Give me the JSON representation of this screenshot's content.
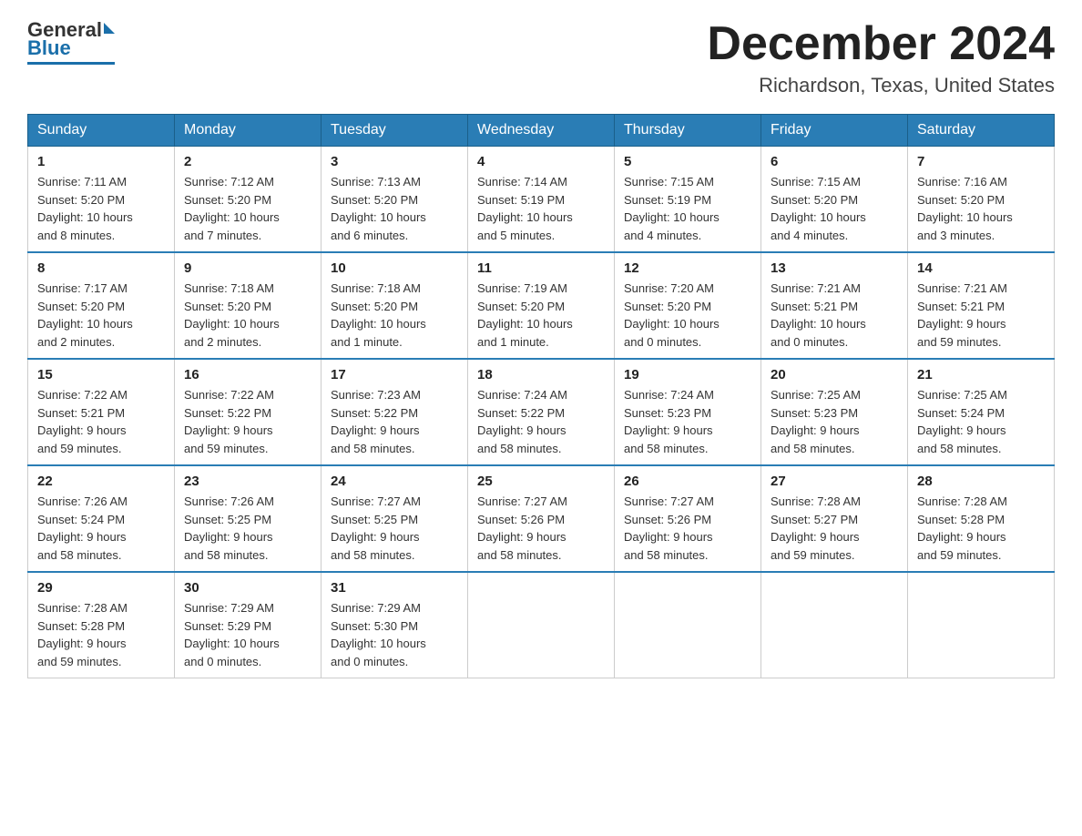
{
  "logo": {
    "general": "General",
    "blue": "Blue"
  },
  "title": "December 2024",
  "subtitle": "Richardson, Texas, United States",
  "days_of_week": [
    "Sunday",
    "Monday",
    "Tuesday",
    "Wednesday",
    "Thursday",
    "Friday",
    "Saturday"
  ],
  "weeks": [
    [
      {
        "day": "1",
        "sunrise": "7:11 AM",
        "sunset": "5:20 PM",
        "daylight": "10 hours and 8 minutes."
      },
      {
        "day": "2",
        "sunrise": "7:12 AM",
        "sunset": "5:20 PM",
        "daylight": "10 hours and 7 minutes."
      },
      {
        "day": "3",
        "sunrise": "7:13 AM",
        "sunset": "5:20 PM",
        "daylight": "10 hours and 6 minutes."
      },
      {
        "day": "4",
        "sunrise": "7:14 AM",
        "sunset": "5:19 PM",
        "daylight": "10 hours and 5 minutes."
      },
      {
        "day": "5",
        "sunrise": "7:15 AM",
        "sunset": "5:19 PM",
        "daylight": "10 hours and 4 minutes."
      },
      {
        "day": "6",
        "sunrise": "7:15 AM",
        "sunset": "5:20 PM",
        "daylight": "10 hours and 4 minutes."
      },
      {
        "day": "7",
        "sunrise": "7:16 AM",
        "sunset": "5:20 PM",
        "daylight": "10 hours and 3 minutes."
      }
    ],
    [
      {
        "day": "8",
        "sunrise": "7:17 AM",
        "sunset": "5:20 PM",
        "daylight": "10 hours and 2 minutes."
      },
      {
        "day": "9",
        "sunrise": "7:18 AM",
        "sunset": "5:20 PM",
        "daylight": "10 hours and 2 minutes."
      },
      {
        "day": "10",
        "sunrise": "7:18 AM",
        "sunset": "5:20 PM",
        "daylight": "10 hours and 1 minute."
      },
      {
        "day": "11",
        "sunrise": "7:19 AM",
        "sunset": "5:20 PM",
        "daylight": "10 hours and 1 minute."
      },
      {
        "day": "12",
        "sunrise": "7:20 AM",
        "sunset": "5:20 PM",
        "daylight": "10 hours and 0 minutes."
      },
      {
        "day": "13",
        "sunrise": "7:21 AM",
        "sunset": "5:21 PM",
        "daylight": "10 hours and 0 minutes."
      },
      {
        "day": "14",
        "sunrise": "7:21 AM",
        "sunset": "5:21 PM",
        "daylight": "9 hours and 59 minutes."
      }
    ],
    [
      {
        "day": "15",
        "sunrise": "7:22 AM",
        "sunset": "5:21 PM",
        "daylight": "9 hours and 59 minutes."
      },
      {
        "day": "16",
        "sunrise": "7:22 AM",
        "sunset": "5:22 PM",
        "daylight": "9 hours and 59 minutes."
      },
      {
        "day": "17",
        "sunrise": "7:23 AM",
        "sunset": "5:22 PM",
        "daylight": "9 hours and 58 minutes."
      },
      {
        "day": "18",
        "sunrise": "7:24 AM",
        "sunset": "5:22 PM",
        "daylight": "9 hours and 58 minutes."
      },
      {
        "day": "19",
        "sunrise": "7:24 AM",
        "sunset": "5:23 PM",
        "daylight": "9 hours and 58 minutes."
      },
      {
        "day": "20",
        "sunrise": "7:25 AM",
        "sunset": "5:23 PM",
        "daylight": "9 hours and 58 minutes."
      },
      {
        "day": "21",
        "sunrise": "7:25 AM",
        "sunset": "5:24 PM",
        "daylight": "9 hours and 58 minutes."
      }
    ],
    [
      {
        "day": "22",
        "sunrise": "7:26 AM",
        "sunset": "5:24 PM",
        "daylight": "9 hours and 58 minutes."
      },
      {
        "day": "23",
        "sunrise": "7:26 AM",
        "sunset": "5:25 PM",
        "daylight": "9 hours and 58 minutes."
      },
      {
        "day": "24",
        "sunrise": "7:27 AM",
        "sunset": "5:25 PM",
        "daylight": "9 hours and 58 minutes."
      },
      {
        "day": "25",
        "sunrise": "7:27 AM",
        "sunset": "5:26 PM",
        "daylight": "9 hours and 58 minutes."
      },
      {
        "day": "26",
        "sunrise": "7:27 AM",
        "sunset": "5:26 PM",
        "daylight": "9 hours and 58 minutes."
      },
      {
        "day": "27",
        "sunrise": "7:28 AM",
        "sunset": "5:27 PM",
        "daylight": "9 hours and 59 minutes."
      },
      {
        "day": "28",
        "sunrise": "7:28 AM",
        "sunset": "5:28 PM",
        "daylight": "9 hours and 59 minutes."
      }
    ],
    [
      {
        "day": "29",
        "sunrise": "7:28 AM",
        "sunset": "5:28 PM",
        "daylight": "9 hours and 59 minutes."
      },
      {
        "day": "30",
        "sunrise": "7:29 AM",
        "sunset": "5:29 PM",
        "daylight": "10 hours and 0 minutes."
      },
      {
        "day": "31",
        "sunrise": "7:29 AM",
        "sunset": "5:30 PM",
        "daylight": "10 hours and 0 minutes."
      },
      null,
      null,
      null,
      null
    ]
  ],
  "labels": {
    "sunrise": "Sunrise:",
    "sunset": "Sunset:",
    "daylight": "Daylight:"
  }
}
